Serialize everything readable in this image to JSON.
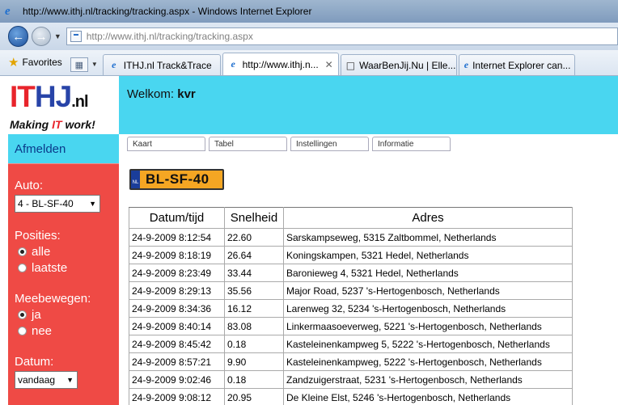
{
  "window": {
    "title": "http://www.ithj.nl/tracking/tracking.aspx - Windows Internet Explorer",
    "address": "http://www.ithj.nl/tracking/tracking.aspx"
  },
  "favorites_label": "Favorites",
  "tabs": [
    {
      "label": "ITHJ.nl Track&Trace",
      "active": false
    },
    {
      "label": "http://www.ithj.n...",
      "active": true
    },
    {
      "label": "WaarBenJij.Nu | Elle...",
      "active": false
    },
    {
      "label": "Internet Explorer can...",
      "active": false
    }
  ],
  "logo": {
    "it": "IT",
    "hj": "HJ",
    "nl": ".nl",
    "tag_pre": "Making ",
    "tag_it": "IT",
    "tag_post": " work!"
  },
  "header": {
    "welcome": "Welkom:",
    "user": "kvr"
  },
  "sidebar": {
    "logout": "Afmelden",
    "auto_label": "Auto:",
    "auto_value": "4 - BL-SF-40",
    "posities_label": "Posities:",
    "posities_options": [
      "alle",
      "laatste"
    ],
    "meebewegen_label": "Meebewegen:",
    "meebewegen_options": [
      "ja",
      "nee"
    ],
    "datum_label": "Datum:",
    "datum_value": "vandaag"
  },
  "content_tabs": [
    "Kaart",
    "Tabel",
    "Instellingen",
    "Informatie"
  ],
  "plate": {
    "country": "NL",
    "number": "BL-SF-40"
  },
  "table": {
    "headers": [
      "Datum/tijd",
      "Snelheid",
      "Adres"
    ],
    "rows": [
      [
        "24-9-2009 8:12:54",
        "22.60",
        "Sarskampseweg, 5315 Zaltbommel, Netherlands"
      ],
      [
        "24-9-2009 8:18:19",
        "26.64",
        "Koningskampen, 5321 Hedel, Netherlands"
      ],
      [
        "24-9-2009 8:23:49",
        "33.44",
        "Baronieweg 4, 5321 Hedel, Netherlands"
      ],
      [
        "24-9-2009 8:29:13",
        "35.56",
        "Major Road, 5237 's-Hertogenbosch, Netherlands"
      ],
      [
        "24-9-2009 8:34:36",
        "16.12",
        "Larenweg 32, 5234 's-Hertogenbosch, Netherlands"
      ],
      [
        "24-9-2009 8:40:14",
        "83.08",
        "Linkermaasoeverweg, 5221 's-Hertogenbosch, Netherlands"
      ],
      [
        "24-9-2009 8:45:42",
        "0.18",
        "Kasteleinenkampweg 5, 5222 's-Hertogenbosch, Netherlands"
      ],
      [
        "24-9-2009 8:57:21",
        "9.90",
        "Kasteleinenkampweg, 5222 's-Hertogenbosch, Netherlands"
      ],
      [
        "24-9-2009 9:02:46",
        "0.18",
        "Zandzuigerstraat, 5231 's-Hertogenbosch, Netherlands"
      ],
      [
        "24-9-2009 9:08:12",
        "20.95",
        "De Kleine Elst, 5246 's-Hertogenbosch, Netherlands"
      ]
    ]
  }
}
